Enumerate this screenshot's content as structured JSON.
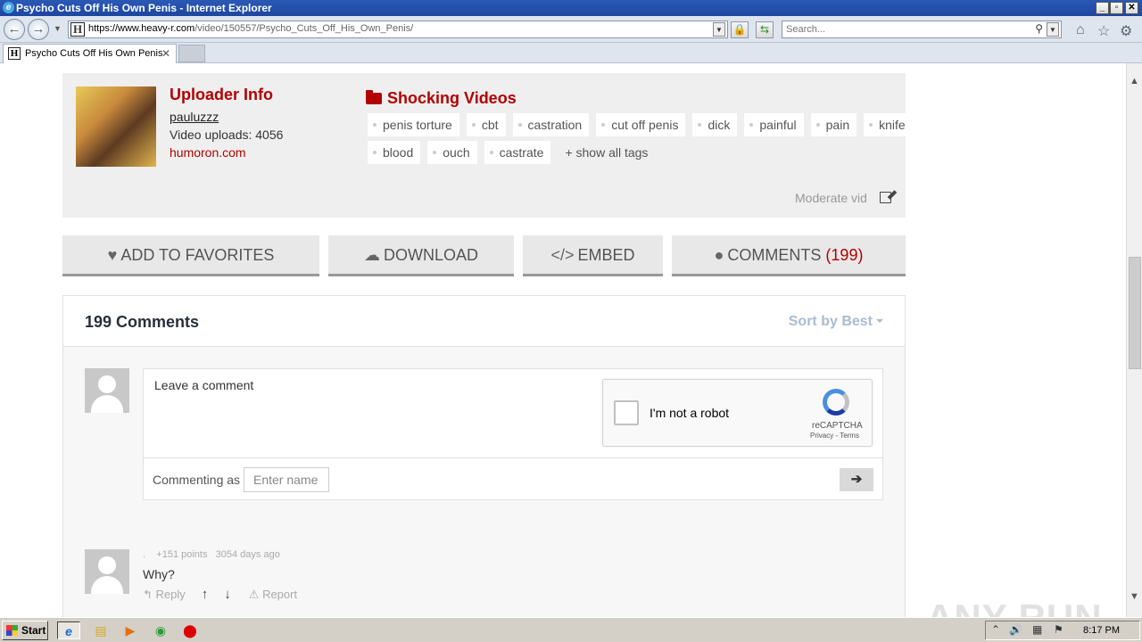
{
  "window": {
    "title": "Psycho Cuts Off His Own Penis - Internet Explorer",
    "min_glyph": "_",
    "max_glyph": "▫",
    "close_glyph": "✕"
  },
  "browser": {
    "url_host": "https://www.heavy-r.com",
    "url_path": "/video/150557/Psycho_Cuts_Off_His_Own_Penis/",
    "search_placeholder": "Search...",
    "favicon_letter": "H",
    "tab_title": "Psycho Cuts Off His Own Penis",
    "tab_close": "✕"
  },
  "uploader": {
    "title": "Uploader Info",
    "name": "pauluzzz",
    "uploads": "Video uploads: 4056",
    "site": "humoron.com"
  },
  "category": {
    "name": "Shocking Videos"
  },
  "tags": {
    "row1": [
      "penis torture",
      "cbt",
      "castration",
      "cut off penis",
      "dick",
      "painful",
      "pain",
      "knife"
    ],
    "row2": [
      "blood",
      "ouch",
      "castrate"
    ],
    "show_all": "+ show all tags"
  },
  "moderate_label": "Moderate vid",
  "actions": {
    "favorites": "ADD TO FAVORITES",
    "download": "DOWNLOAD",
    "embed": "EMBED",
    "comments": "COMMENTS",
    "comments_count": "(199)"
  },
  "comments": {
    "header": "199 Comments",
    "sort_label": "Sort by Best",
    "compose_placeholder": "Leave a comment",
    "captcha_label": "I'm not a robot",
    "captcha_brand": "reCAPTCHA",
    "captcha_links": "Privacy - Terms",
    "commenting_as": "Commenting as",
    "name_placeholder": "Enter name",
    "items": [
      {
        "author": ".",
        "points": "+151 points",
        "age": "3054 days ago",
        "text": "Why?",
        "reply": "Reply",
        "report": "Report"
      }
    ]
  },
  "watermark": "ANY RUN",
  "taskbar": {
    "start": "Start",
    "time": "8:17 PM"
  }
}
